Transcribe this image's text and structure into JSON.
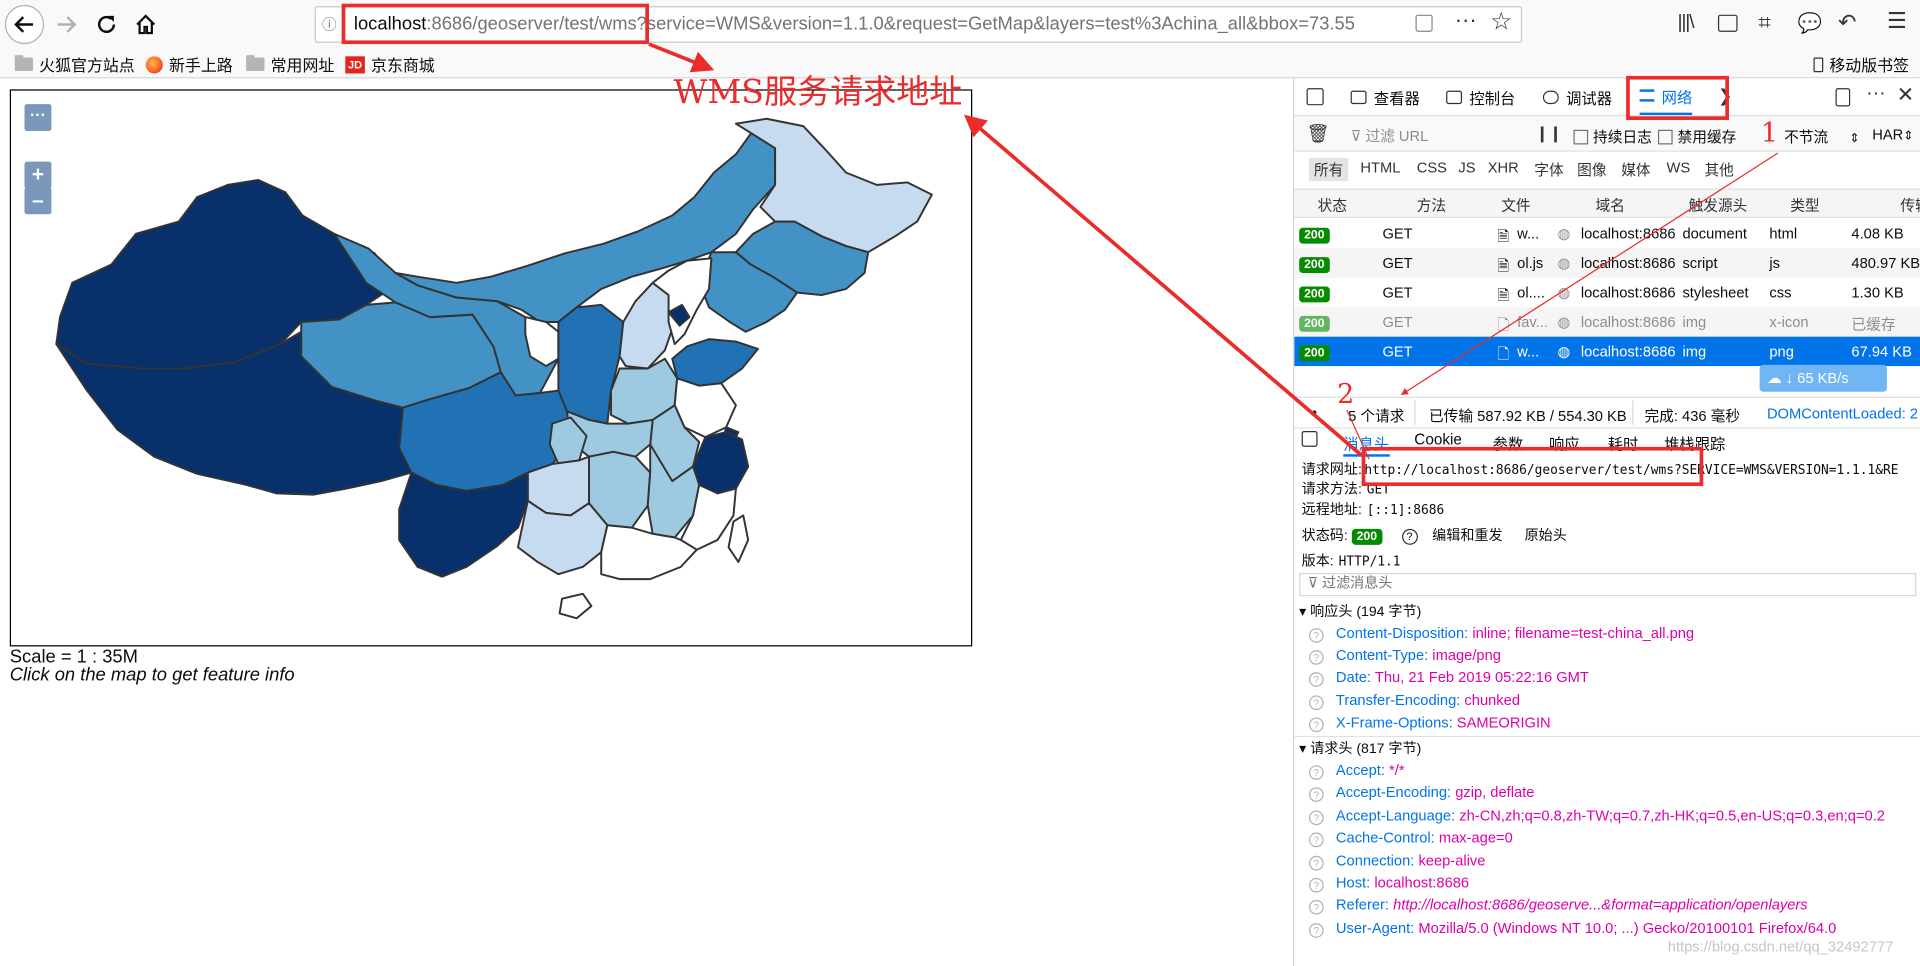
{
  "browser": {
    "url_host": "localhost",
    "url_rest": ":8686/geoserver/test/wms?service=WMS&version=1.1.0&request=GetMap&layers=test%3Achina_all&bbox=73.55",
    "mobile_bookmarks": "移动版书签"
  },
  "bookmarks": [
    {
      "label": "火狐官方站点",
      "icon": "folder-icon"
    },
    {
      "label": "新手上路",
      "icon": "firefox-icon"
    },
    {
      "label": "常用网址",
      "icon": "folder-icon"
    },
    {
      "label": "京东商城",
      "icon": "jd-icon"
    }
  ],
  "jd_logo": "JD",
  "map": {
    "scale_text": "Scale = 1 : 35M",
    "hint": "Click on the map to get feature info",
    "zoom_in": "+",
    "zoom_out": "–",
    "menu_dots": "···"
  },
  "annotations": {
    "title": "WMS服务请求地址",
    "num1": "1",
    "num2": "2",
    "color": "#ea2c2c"
  },
  "devtools": {
    "tabs": {
      "inspector": "查看器",
      "console": "控制台",
      "debugger": "调试器",
      "network": "网络"
    },
    "filter_placeholder": "过滤 URL",
    "persist_logs": "持续日志",
    "disable_cache": "禁用缓存",
    "throttling": "不节流",
    "har": "HAR",
    "types": [
      "所有",
      "HTML",
      "CSS",
      "JS",
      "XHR",
      "字体",
      "图像",
      "媒体",
      "WS",
      "其他"
    ],
    "columns": [
      "状态",
      "方法",
      "文件",
      "域名",
      "触发源头",
      "类型",
      "传输"
    ],
    "requests": [
      {
        "status": "200",
        "method": "GET",
        "file": "w...",
        "domain": "localhost:8686",
        "cause": "document",
        "type": "html",
        "size": "4.08 KB"
      },
      {
        "status": "200",
        "method": "GET",
        "file": "ol.js",
        "domain": "localhost:8686",
        "cause": "script",
        "type": "js",
        "size": "480.97 KB"
      },
      {
        "status": "200",
        "method": "GET",
        "file": "ol....",
        "domain": "localhost:8686",
        "cause": "stylesheet",
        "type": "css",
        "size": "1.30 KB"
      },
      {
        "status": "200",
        "method": "GET",
        "file": "fav...",
        "domain": "localhost:8686",
        "cause": "img",
        "type": "x-icon",
        "size": "已缓存"
      },
      {
        "status": "200",
        "method": "GET",
        "file": "w...",
        "domain": "localhost:8686",
        "cause": "img",
        "type": "png",
        "size": "67.94 KB"
      }
    ],
    "speed": "65 KB/s",
    "summary": {
      "count": "5 个请求",
      "transferred": "已传输 587.92 KB / 554.30 KB",
      "finish": "完成: 436 毫秒",
      "dcl": "DOMContentLoaded: 2"
    },
    "detail_tabs": [
      "消息头",
      "Cookie",
      "参数",
      "响应",
      "耗时",
      "堆栈跟踪"
    ],
    "request_url_label": "请求网址:",
    "request_url": "http://localhost:8686/geoserver/test/wms?SERVICE=WMS&VERSION=1.1.1&RE",
    "request_method_label": "请求方法:",
    "request_method": "GET",
    "remote_label": "远程地址:",
    "remote": "[::1]:8686",
    "status_label": "状态码:",
    "status_code": "200",
    "edit_resend": "编辑和重发",
    "raw_headers": "原始头",
    "version_label": "版本:",
    "version": "HTTP/1.1",
    "filter_headers": "过滤消息头",
    "response_headers_title": "响应头 (194 字节)",
    "response_headers": [
      {
        "k": "Content-Disposition:",
        "v": "inline; filename=test-china_all.png"
      },
      {
        "k": "Content-Type:",
        "v": "image/png"
      },
      {
        "k": "Date:",
        "v": "Thu, 21 Feb 2019 05:22:16 GMT"
      },
      {
        "k": "Transfer-Encoding:",
        "v": "chunked"
      },
      {
        "k": "X-Frame-Options:",
        "v": "SAMEORIGIN"
      }
    ],
    "request_headers_title": "请求头 (817 字节)",
    "request_headers": [
      {
        "k": "Accept:",
        "v": "*/*"
      },
      {
        "k": "Accept-Encoding:",
        "v": "gzip, deflate"
      },
      {
        "k": "Accept-Language:",
        "v": "zh-CN,zh;q=0.8,zh-TW;q=0.7,zh-HK;q=0.5,en-US;q=0.3,en;q=0.2"
      },
      {
        "k": "Cache-Control:",
        "v": "max-age=0"
      },
      {
        "k": "Connection:",
        "v": "keep-alive"
      },
      {
        "k": "Host:",
        "v": "localhost:8686"
      },
      {
        "k": "Referer:",
        "v": "http://localhost:8686/geoserve...&format=application/openlayers"
      },
      {
        "k": "User-Agent:",
        "v": "Mozilla/5.0 (Windows NT 10.0; ...) Gecko/20100101 Firefox/64.0"
      }
    ],
    "watermark": "https://blog.csdn.net/qq_32492777"
  }
}
